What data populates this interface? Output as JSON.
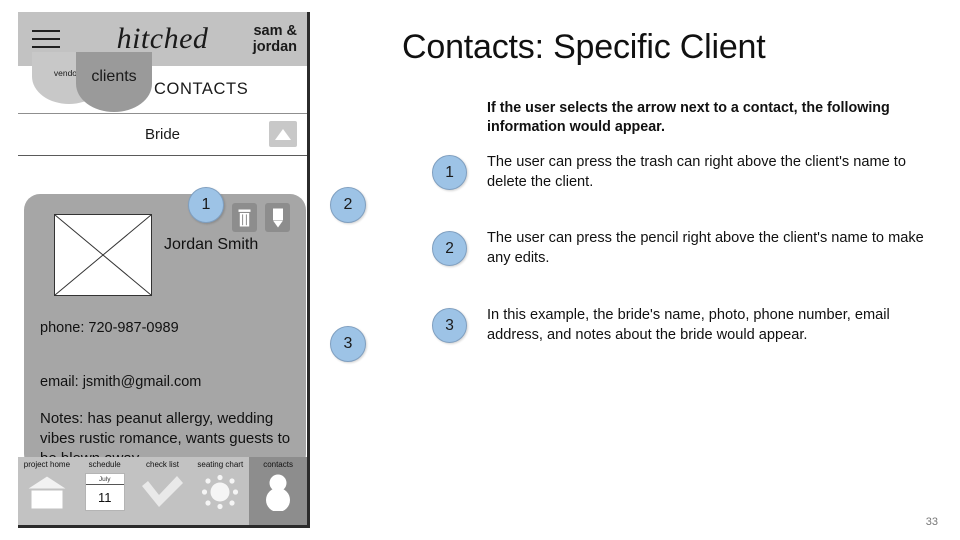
{
  "slide": {
    "title": "Contacts: Specific Client",
    "intro": "If the user selects the arrow next to a contact, the following information would appear.",
    "page_number": "33",
    "accent_color": "#9dc3e6"
  },
  "notes": [
    {
      "num": "1",
      "text": "The user can press the trash can right above the client's name to delete the client."
    },
    {
      "num": "2",
      "text": "The user can press the pencil right above the client's name to make any edits."
    },
    {
      "num": "3",
      "text": "In this example, the bride's name, photo, phone number, email address, and notes about the bride would appear."
    }
  ],
  "callouts": [
    {
      "num": "1"
    },
    {
      "num": "2"
    },
    {
      "num": "3"
    }
  ],
  "phone": {
    "topbar": {
      "menu_icon": "hamburger-icon",
      "brand": "hitched",
      "couple_line1": "sam &",
      "couple_line2": "jordan"
    },
    "tabs": [
      {
        "label": "vendors",
        "active": false
      },
      {
        "label": "clients",
        "active": true
      }
    ],
    "screen_title": "CONTACTS",
    "section": {
      "label": "Bride",
      "collapse_icon": "triangle-up-icon"
    },
    "client": {
      "photo_placeholder": "image-placeholder",
      "name": "Jordan Smith",
      "trash_icon": "trash-icon",
      "pencil_icon": "pencil-icon",
      "phone": "phone: 720-987-0989",
      "email": "email: jsmith@gmail.com",
      "notes": "Notes:  has peanut allergy, wedding vibes rustic romance, wants guests to be blown away"
    },
    "bottom_nav": [
      {
        "label": "project home",
        "icon": "home-icon",
        "active": false
      },
      {
        "label": "schedule",
        "icon": "calendar-icon",
        "active": false,
        "month": "July",
        "day": "11"
      },
      {
        "label": "check list",
        "icon": "check-icon",
        "active": false
      },
      {
        "label": "seating chart",
        "icon": "round-table-icon",
        "active": false
      },
      {
        "label": "contacts",
        "icon": "person-icon",
        "active": true
      }
    ]
  }
}
